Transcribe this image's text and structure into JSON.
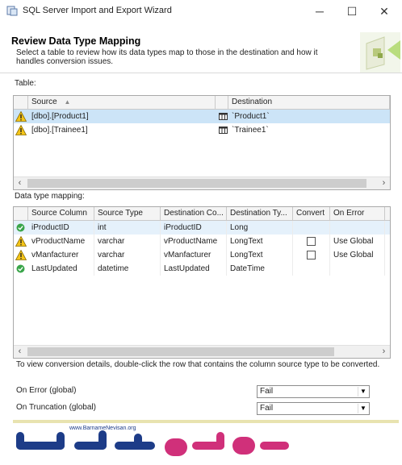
{
  "window": {
    "title": "SQL Server Import and Export Wizard",
    "minimize": "─",
    "maximize": "☐",
    "close": "✕"
  },
  "header": {
    "title": "Review Data Type Mapping",
    "subtitle": "Select a table to review how its data types map to those in the destination and how it handles conversion issues."
  },
  "table_section": {
    "label": "Table:",
    "columns": {
      "source": "Source",
      "destination": "Destination"
    },
    "rows": [
      {
        "source": "[dbo].[Product1]",
        "destination": "`Product1`",
        "status": "warning"
      },
      {
        "source": "[dbo].[Trainee1]",
        "destination": "`Trainee1`",
        "status": "warning"
      }
    ]
  },
  "mapping_section": {
    "label": "Data type mapping:",
    "columns": [
      "Source Column",
      "Source Type",
      "Destination Co...",
      "Destination Ty...",
      "Convert",
      "On Error"
    ],
    "rows": [
      {
        "status": "ok",
        "source_column": "iProductID",
        "source_type": "int",
        "dest_column": "iProductID",
        "dest_type": "Long",
        "convert": "",
        "on_error": ""
      },
      {
        "status": "warning",
        "source_column": "vProductName",
        "source_type": "varchar",
        "dest_column": "vProductName",
        "dest_type": "LongText",
        "convert": "unchecked",
        "on_error": "Use Global"
      },
      {
        "status": "warning",
        "source_column": "vManfacturer",
        "source_type": "varchar",
        "dest_column": "vManfacturer",
        "dest_type": "LongText",
        "convert": "unchecked",
        "on_error": "Use Global"
      },
      {
        "status": "ok",
        "source_column": "LastUpdated",
        "source_type": "datetime",
        "dest_column": "LastUpdated",
        "dest_type": "DateTime",
        "convert": "",
        "on_error": ""
      }
    ]
  },
  "hint": "To view conversion details, double-click the row that contains the column source type to be converted.",
  "on_error_global": {
    "label": "On Error (global)",
    "value": "Fail"
  },
  "on_truncation_global": {
    "label": "On Truncation (global)",
    "value": "Fail"
  },
  "watermark": {
    "url_text": "www.BarnameNevisan.org"
  },
  "colors": {
    "selection": "#cce4f7",
    "warning": "#f5c518",
    "ok": "#3aa54a",
    "brand": "#1d3c88"
  }
}
